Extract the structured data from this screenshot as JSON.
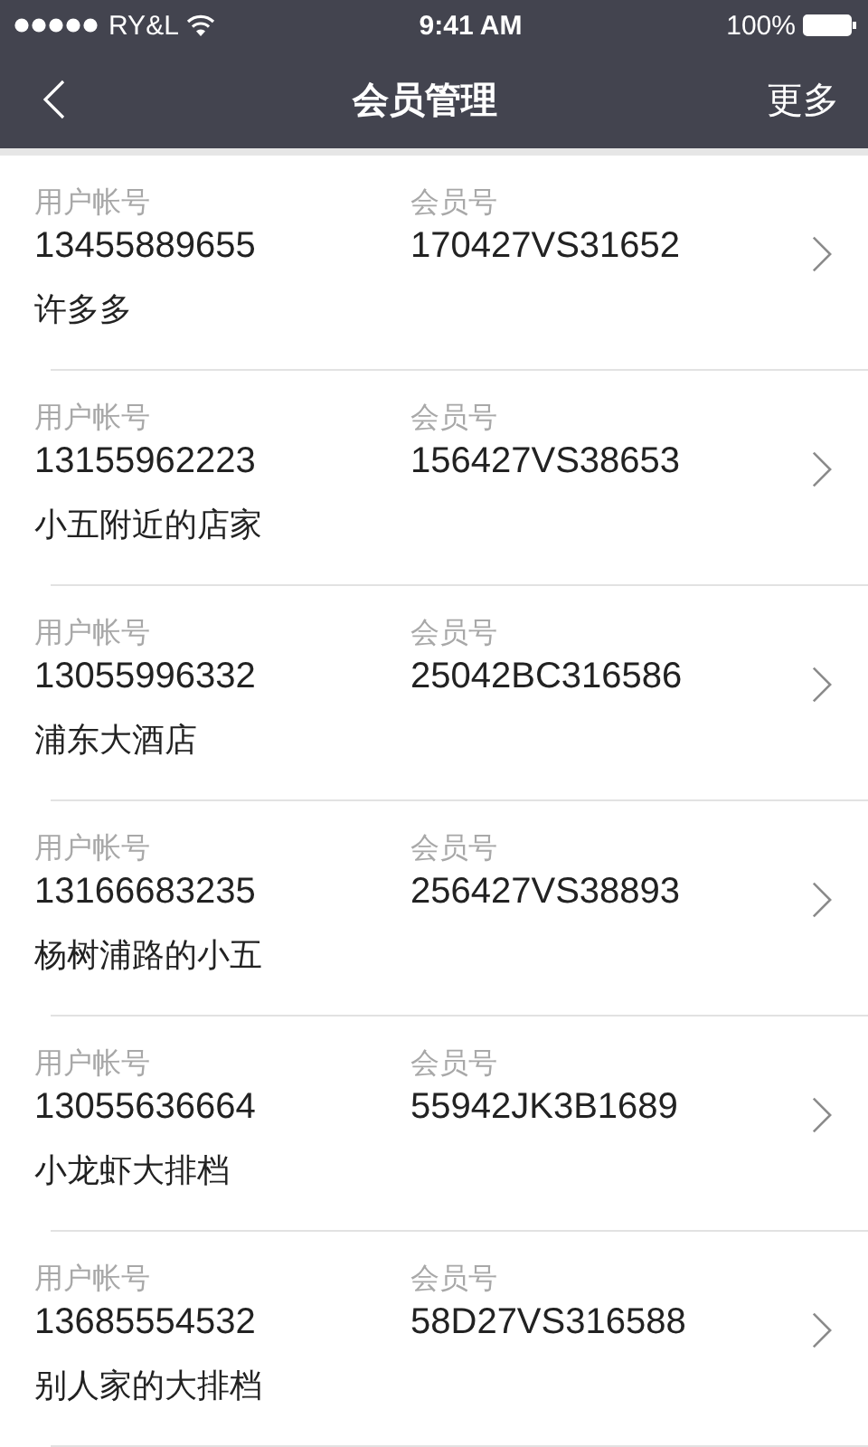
{
  "status_bar": {
    "carrier": "RY&L",
    "time": "9:41 AM",
    "battery": "100%"
  },
  "nav": {
    "title": "会员管理",
    "action": "更多"
  },
  "members": [
    {
      "account_label": "用户帐号",
      "account": "13455889655",
      "member_label": "会员号",
      "member_no": "170427VS31652",
      "name": "许多多"
    },
    {
      "account_label": "用户帐号",
      "account": "13155962223",
      "member_label": "会员号",
      "member_no": "156427VS38653",
      "name": "小五附近的店家"
    },
    {
      "account_label": "用户帐号",
      "account": "13055996332",
      "member_label": "会员号",
      "member_no": "25042BC316586",
      "name": "浦东大酒店"
    },
    {
      "account_label": "用户帐号",
      "account": "13166683235",
      "member_label": "会员号",
      "member_no": "256427VS38893",
      "name": "杨树浦路的小五"
    },
    {
      "account_label": "用户帐号",
      "account": "13055636664",
      "member_label": "会员号",
      "member_no": "55942JK3B1689",
      "name": "小龙虾大排档"
    },
    {
      "account_label": "用户帐号",
      "account": "13685554532",
      "member_label": "会员号",
      "member_no": "58D27VS316588",
      "name": "别人家的大排档"
    }
  ]
}
